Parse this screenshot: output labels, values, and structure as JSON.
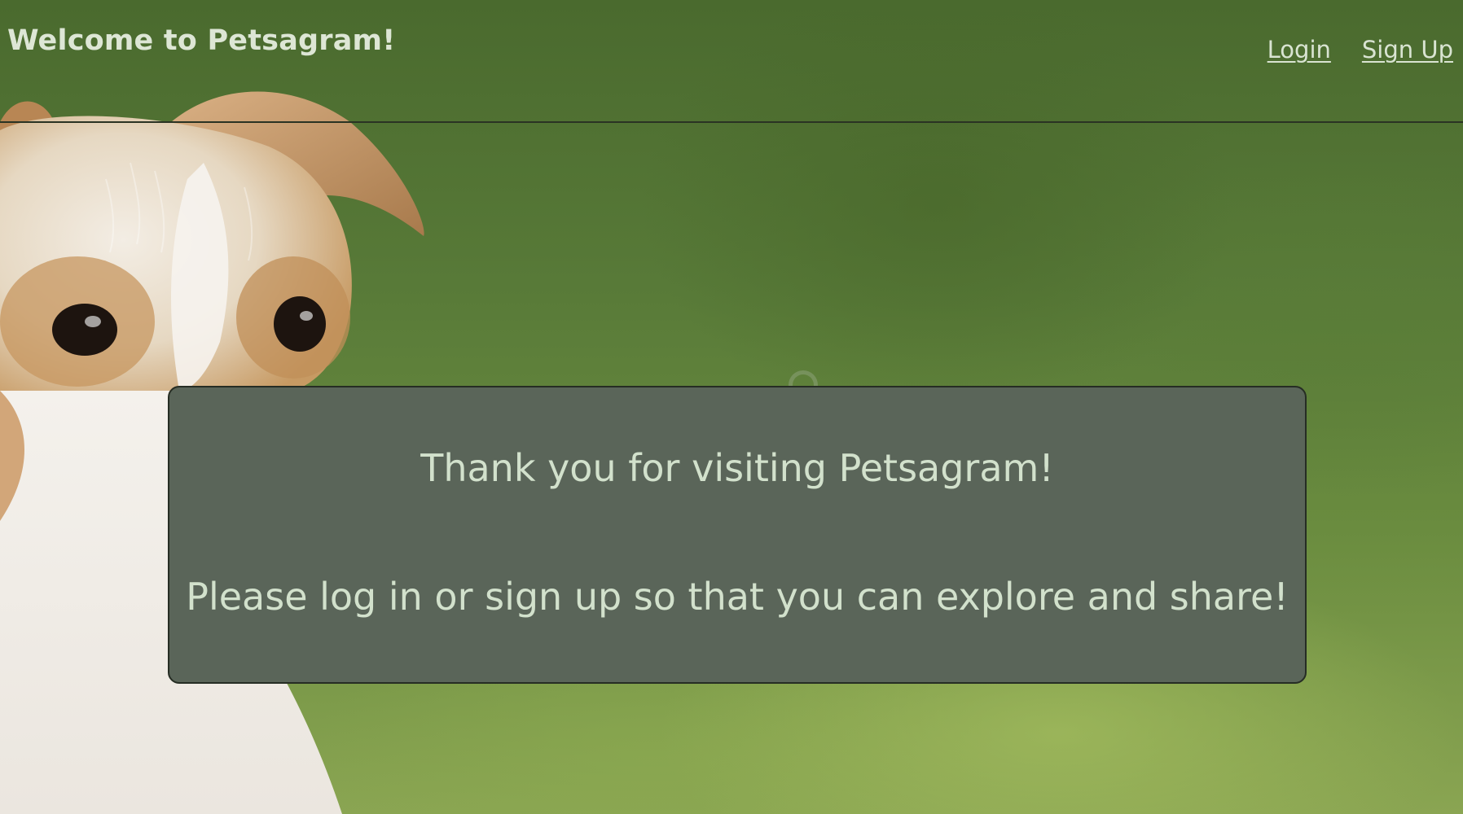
{
  "header": {
    "title": "Welcome to Petsagram!",
    "nav": {
      "login_label": "Login",
      "signup_label": "Sign Up"
    }
  },
  "message": {
    "line1": "Thank you for visiting Petsagram!",
    "line2": "Please log in or sign up so that you can explore and share!"
  },
  "colors": {
    "background": "#5f8039",
    "panel": "#5a6559",
    "text": "#d2e1cc"
  },
  "icons": {
    "background_image": "dog-photo",
    "loader": "loading-spinner-icon"
  }
}
